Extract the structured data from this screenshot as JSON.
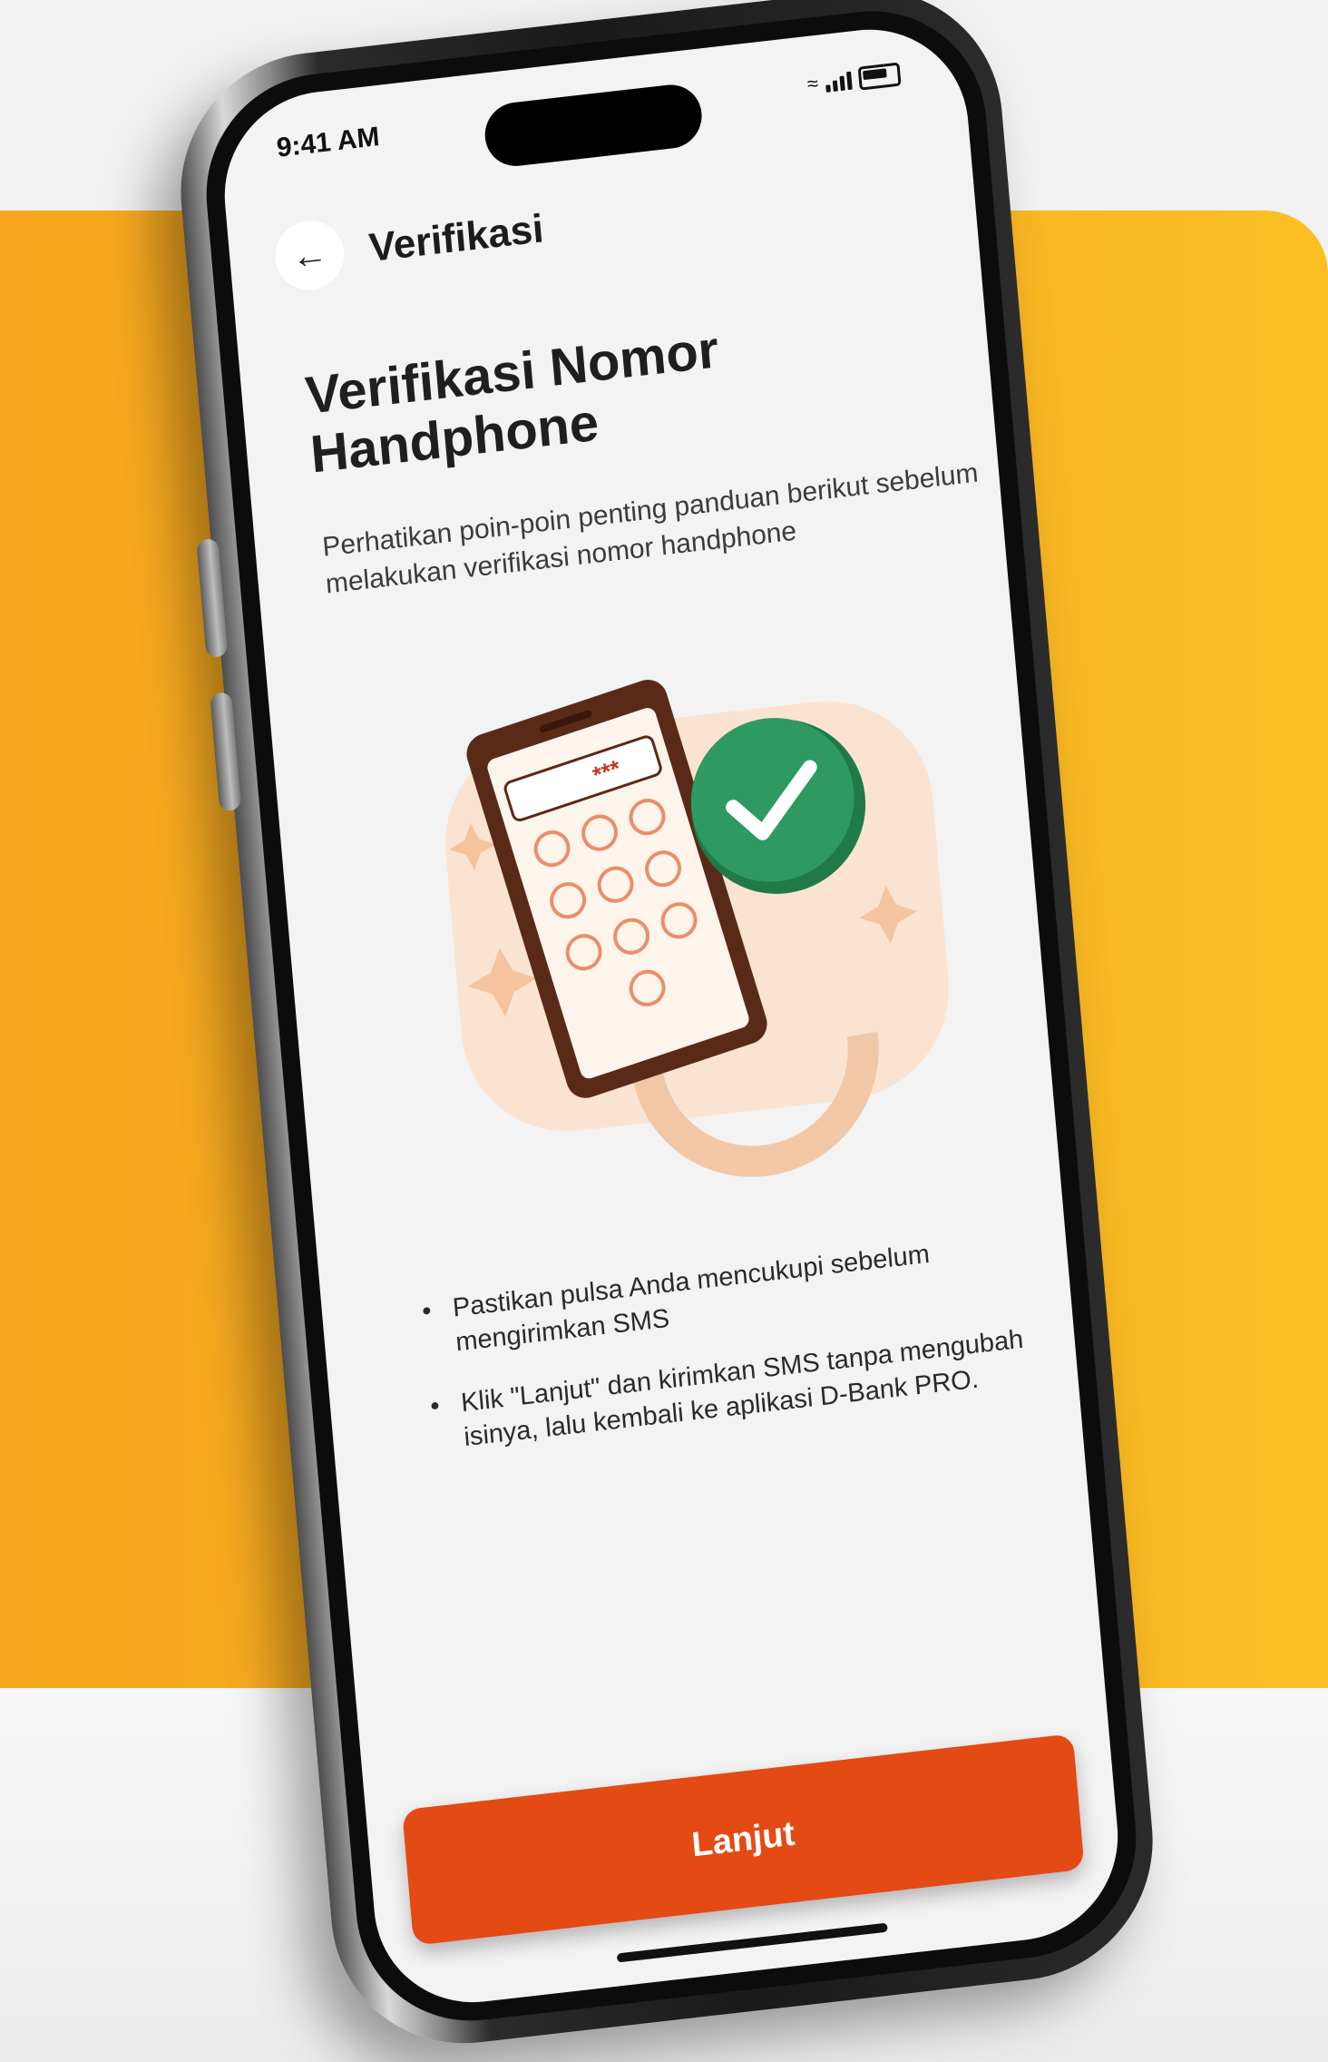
{
  "status_bar": {
    "time": "9:41 AM"
  },
  "header": {
    "back_icon": "arrow-left-icon",
    "title": "Verifikasi"
  },
  "page": {
    "title": "Verifikasi Nomor Handphone",
    "description": "Perhatikan poin-poin penting panduan berikut sebelum melakukan verifikasi nomor handphone"
  },
  "illustration": {
    "pin_mask": "***"
  },
  "tips": [
    "Pastikan pulsa Anda mencukupi sebelum mengirimkan SMS",
    "Klik \"Lanjut\" dan kirimkan SMS tanpa mengubah isinya, lalu kembali ke aplikasi D-Bank PRO."
  ],
  "cta": {
    "label": "Lanjut"
  },
  "colors": {
    "background_yellow": "#f8b021",
    "cta": "#e44a14",
    "check_green": "#2e9a61",
    "phone_brown": "#5a2a18",
    "keypad_orange": "#e98f6a"
  }
}
